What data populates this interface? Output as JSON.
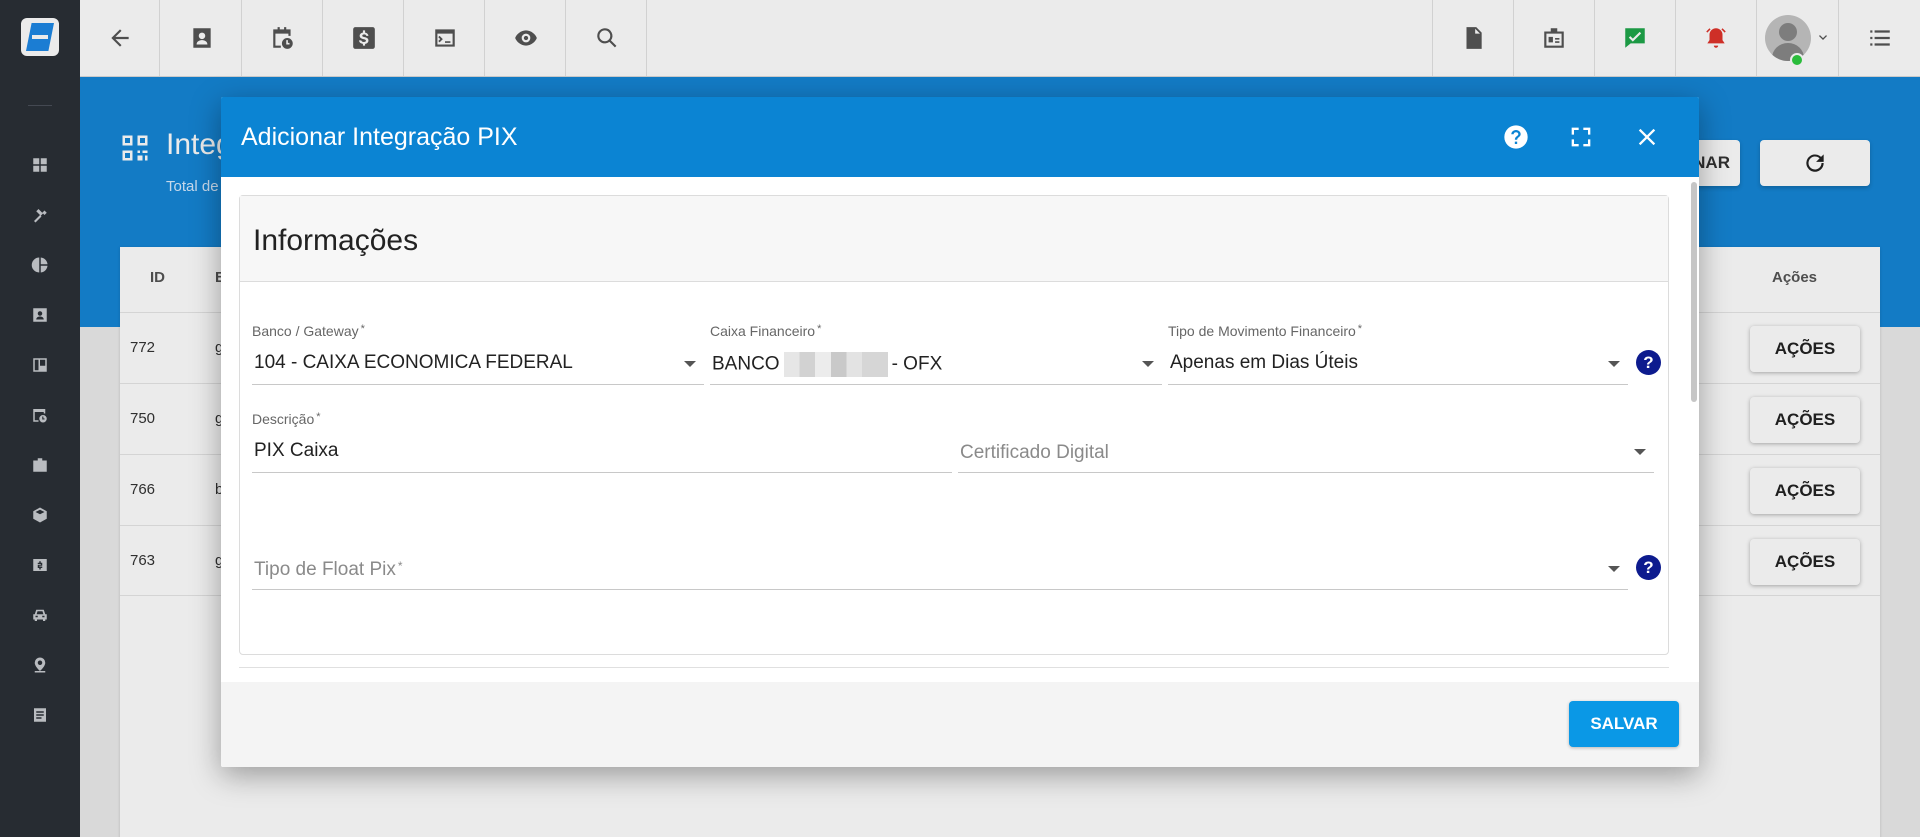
{
  "topbar": {
    "left_buttons": [
      "back-arrow-icon",
      "contact-card-icon",
      "calendar-clock-icon",
      "dollar-icon",
      "terminal-icon",
      "eye-icon",
      "search-icon"
    ],
    "right_buttons": [
      "pdf-file-icon",
      "badge-id-icon",
      "check-message-icon",
      "alarm-bell-icon",
      "user-avatar",
      "list-menu-icon"
    ],
    "accent_colors": {
      "green": "#1fa64a",
      "red": "#e0342b"
    }
  },
  "sidebar": {
    "icons": [
      "dashboard-icon",
      "gavel-icon",
      "pie-chart-icon",
      "contact-card-icon",
      "kanban-icon",
      "calendar-clock-icon",
      "badge-id-icon",
      "box-icon",
      "money-icon",
      "car-icon",
      "map-pin-icon",
      "document-icon"
    ]
  },
  "background_page": {
    "title": "Integ",
    "subtitle": "Total de",
    "button_partial": "NAR",
    "columns": {
      "id": "ID",
      "b": "B",
      "acoes": "Ações"
    },
    "rows": [
      {
        "id": "772",
        "b": "g",
        "action": "AÇÕES"
      },
      {
        "id": "750",
        "b": "g",
        "action": "AÇÕES"
      },
      {
        "id": "766",
        "b": "b",
        "action": "AÇÕES"
      },
      {
        "id": "763",
        "b": "g",
        "action": "AÇÕES"
      }
    ]
  },
  "modal": {
    "title": "Adicionar Integração PIX",
    "section_title": "Informações",
    "fields": {
      "banco": {
        "label": "Banco / Gateway",
        "value": "104 - CAIXA ECONOMICA FEDERAL"
      },
      "caixa": {
        "label": "Caixa Financeiro",
        "value_prefix": "BANCO",
        "value_suffix": "- OFX"
      },
      "tipo_mov": {
        "label": "Tipo de Movimento Financeiro",
        "value": "Apenas em Dias Úteis"
      },
      "descricao": {
        "label": "Descrição",
        "value": "PIX Caixa"
      },
      "certificado": {
        "placeholder": "Certificado Digital"
      },
      "float_pix": {
        "placeholder": "Tipo de Float Pix"
      }
    },
    "required_mark": "*",
    "help_mark": "?",
    "save_label": "SALVAR"
  }
}
